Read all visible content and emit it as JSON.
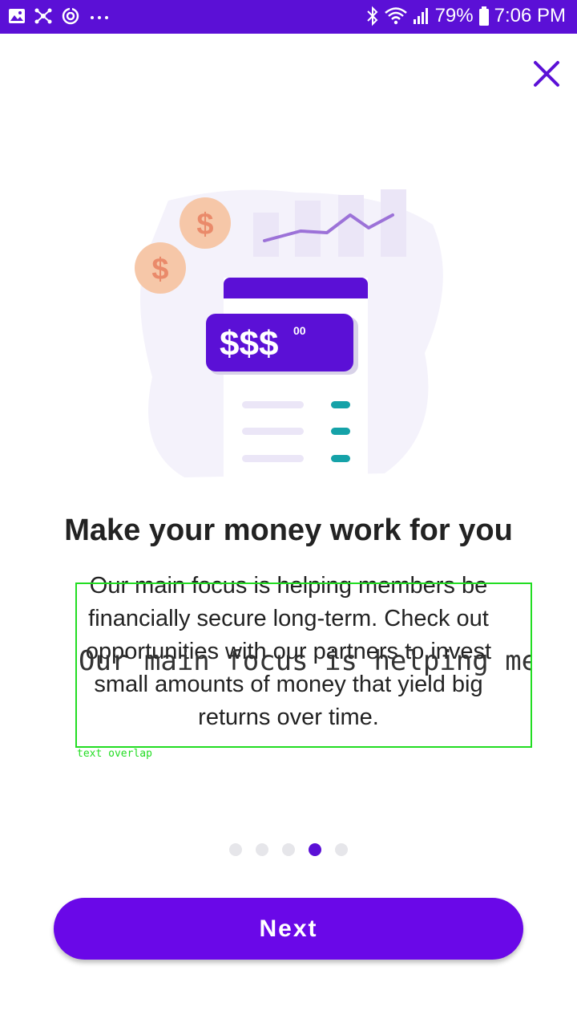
{
  "status_bar": {
    "battery": "79%",
    "time": "7:06 PM",
    "icons": [
      "gallery-icon",
      "network-icon",
      "sync-icon",
      "more-icon",
      "bluetooth-icon",
      "wifi-icon",
      "signal-icon",
      "battery-icon"
    ]
  },
  "illustration": {
    "amount": "$$$",
    "cents": "00",
    "coin_symbol": "$"
  },
  "onboarding": {
    "title": "Make your money work for you",
    "body": "Our main focus is helping members be financially secure long-term. Check out opportunities with our partners to invest small amounts of money that yield big returns over time.",
    "overlap_text": "Our main focus is helping members be",
    "overlap_label": "text overlap",
    "page_count": 5,
    "active_page": 4
  },
  "actions": {
    "next_label": "Next",
    "close_icon": "close-icon"
  },
  "colors": {
    "brand": "#5b10d6",
    "button": "#6a08e8",
    "accent_teal": "#15a2a8",
    "coin": "#f6c7a8",
    "overlay_green": "#22dd22"
  }
}
